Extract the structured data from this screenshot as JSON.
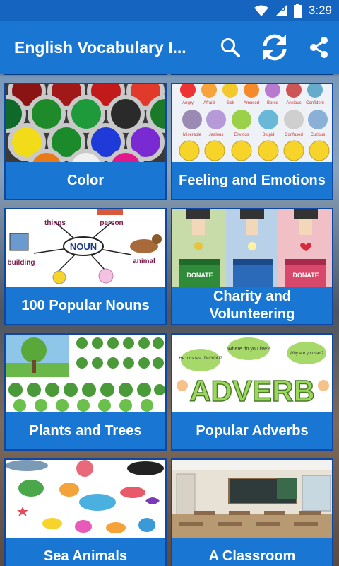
{
  "status_bar": {
    "time": "3:29",
    "battery_level": "8"
  },
  "app_bar": {
    "title": "English Vocabulary I...",
    "search_icon": "search-icon",
    "refresh_icon": "refresh-icon",
    "share_icon": "share-icon"
  },
  "colors": {
    "app_bar": "#1976d2",
    "status_bar": "#1565c0",
    "card_border": "#0d47a1"
  },
  "categories": [
    {
      "label": "Color",
      "image": "paint-cans"
    },
    {
      "label": "Feeling and Emotions",
      "image": "emoji-faces"
    },
    {
      "label": "100 Popular Nouns",
      "image": "noun-diagram"
    },
    {
      "label": "Charity and Volunteering",
      "image": "donation-boxes"
    },
    {
      "label": "Plants and Trees",
      "image": "trees"
    },
    {
      "label": "Popular Adverbs",
      "image": "adverb-kids"
    },
    {
      "label": "Sea Animals",
      "image": "sea-creatures"
    },
    {
      "label": "A Classroom",
      "image": "classroom"
    }
  ],
  "noun_diagram": {
    "center": "NOUN",
    "words": [
      "things",
      "person",
      "building",
      "animal"
    ]
  },
  "donation_labels": [
    "DONATE",
    "DONATE"
  ],
  "adverb_image": {
    "word": "ADVERB",
    "bubbles": [
      "He runs fast. Do YOU?",
      "Where do you live?",
      "Why are you sad?"
    ]
  },
  "emotion_labels": [
    "Angry",
    "Afraid",
    "Sick",
    "Amused",
    "Bored",
    "Anxious",
    "Confident",
    "Miserable",
    "Jealous",
    "Envious",
    "Stupid",
    "Confused",
    "Curious"
  ]
}
